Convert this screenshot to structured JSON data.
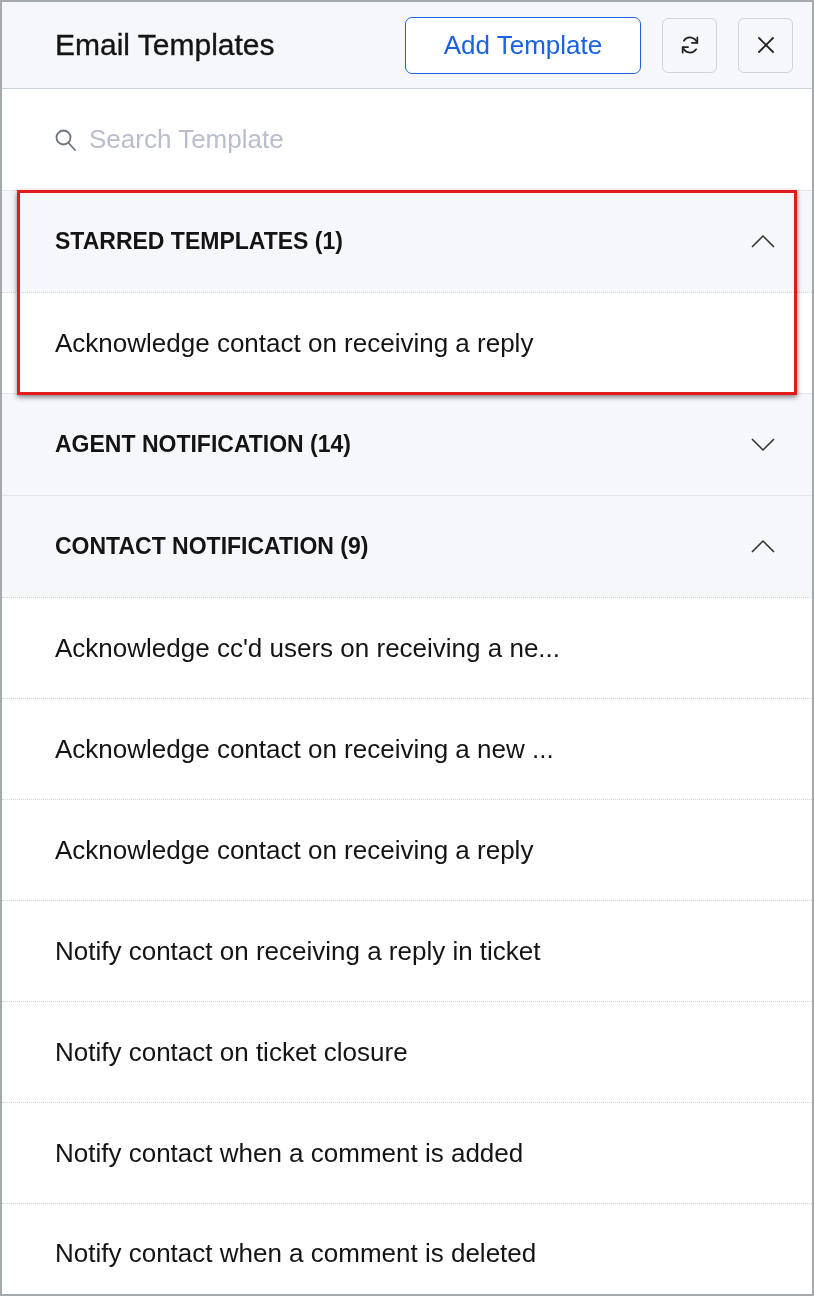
{
  "header": {
    "title": "Email Templates",
    "add_button": "Add Template"
  },
  "search": {
    "placeholder": "Search Template"
  },
  "sections": [
    {
      "title": "STARRED TEMPLATES (1)",
      "expanded": true,
      "highlighted": true,
      "items": [
        "Acknowledge contact on receiving a reply"
      ]
    },
    {
      "title": "AGENT NOTIFICATION (14)",
      "expanded": false,
      "highlighted": false
    },
    {
      "title": "CONTACT NOTIFICATION (9)",
      "expanded": true,
      "highlighted": false,
      "items": [
        "Acknowledge cc'd users on receiving a ne...",
        "Acknowledge contact on receiving a new ...",
        "Acknowledge contact on receiving a reply",
        "Notify contact on receiving a reply in ticket",
        "Notify contact on ticket closure",
        "Notify contact when a comment is added",
        "Notify contact when a comment is deleted"
      ]
    }
  ]
}
